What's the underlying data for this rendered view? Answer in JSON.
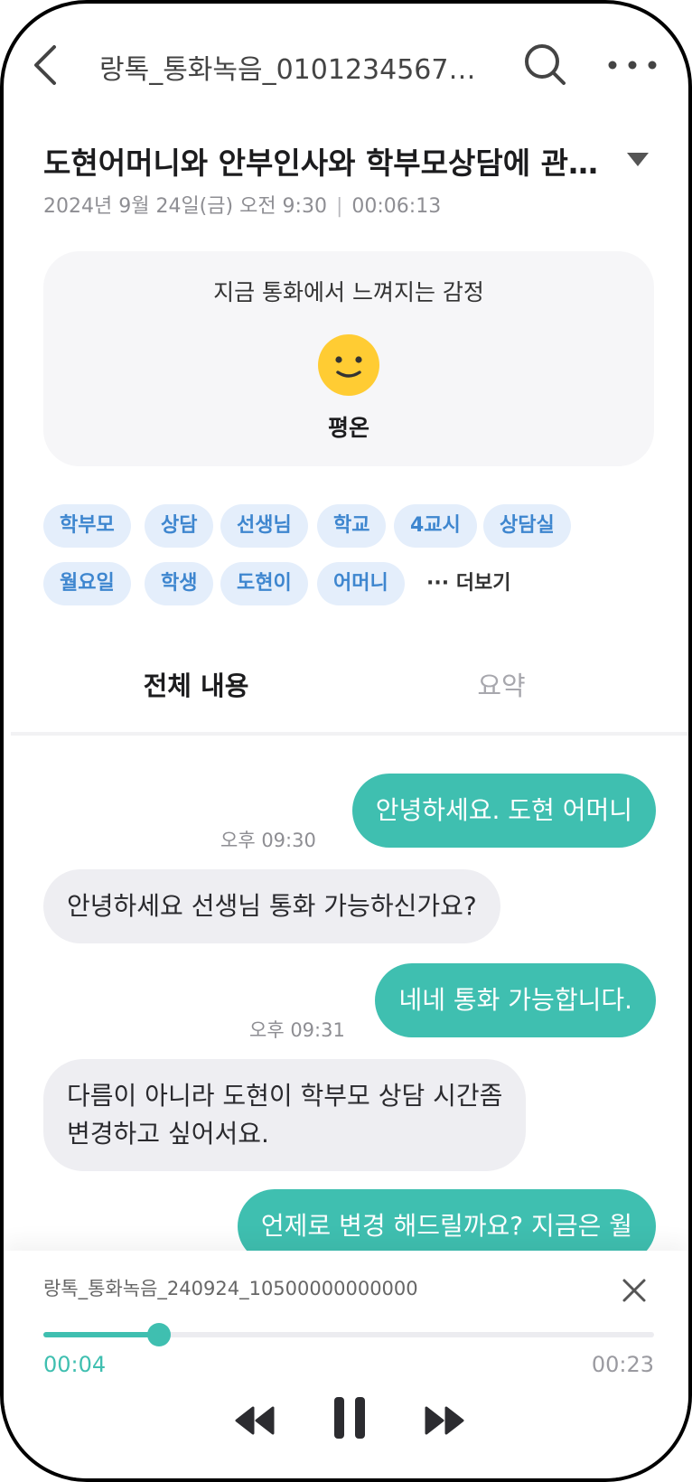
{
  "header": {
    "file_title": "랑톡_통화녹음_01012345678…"
  },
  "record": {
    "title": "도현어머니와 안부인사와 학부모상담에 관…",
    "date": "2024년 9월 24일(금) 오전 9:30",
    "separator": "|",
    "duration": "00:06:13"
  },
  "emotion": {
    "heading": "지금 통화에서 느껴지는 감정",
    "label": "평온",
    "emoji_color": "#ffcc33",
    "icon": "smile-emoji-icon"
  },
  "tags": [
    "학부모",
    "상담",
    "선생님",
    "학교",
    "4교시",
    "상담실",
    "월요일",
    "학생",
    "도현이",
    "어머니"
  ],
  "more_tags_label": "··· 더보기",
  "tabs": {
    "all": "전체 내용",
    "summary": "요약",
    "active": "all"
  },
  "messages": [
    {
      "side": "me",
      "text": "안녕하세요. 도현 어머니",
      "time": "오후 09:30"
    },
    {
      "side": "other",
      "text": "안녕하세요 선생님 통화 가능하신가요?",
      "time": ""
    },
    {
      "side": "me",
      "text": "네네 통화 가능합니다.",
      "time": "오후 09:31"
    },
    {
      "side": "other",
      "text": "다름이 아니라 도현이 학부모 상담 시간좀 변경하고 싶어서요.",
      "line1": "다름이 아니라 도현이 학부모 상담 시간좀",
      "line2": "변경하고 싶어서요.",
      "time": ""
    },
    {
      "side": "me",
      "text": "언제로 변경 해드릴까요? 지금은 월",
      "time": ""
    }
  ],
  "player": {
    "file_name": "랑톡_통화녹음_240924_10500000000000",
    "current_time": "00:04",
    "total_time": "00:23",
    "progress": 0.19
  },
  "colors": {
    "accent": "#3fbfb0",
    "tag_bg": "#e4eefb",
    "tag_text": "#3e86cf"
  }
}
